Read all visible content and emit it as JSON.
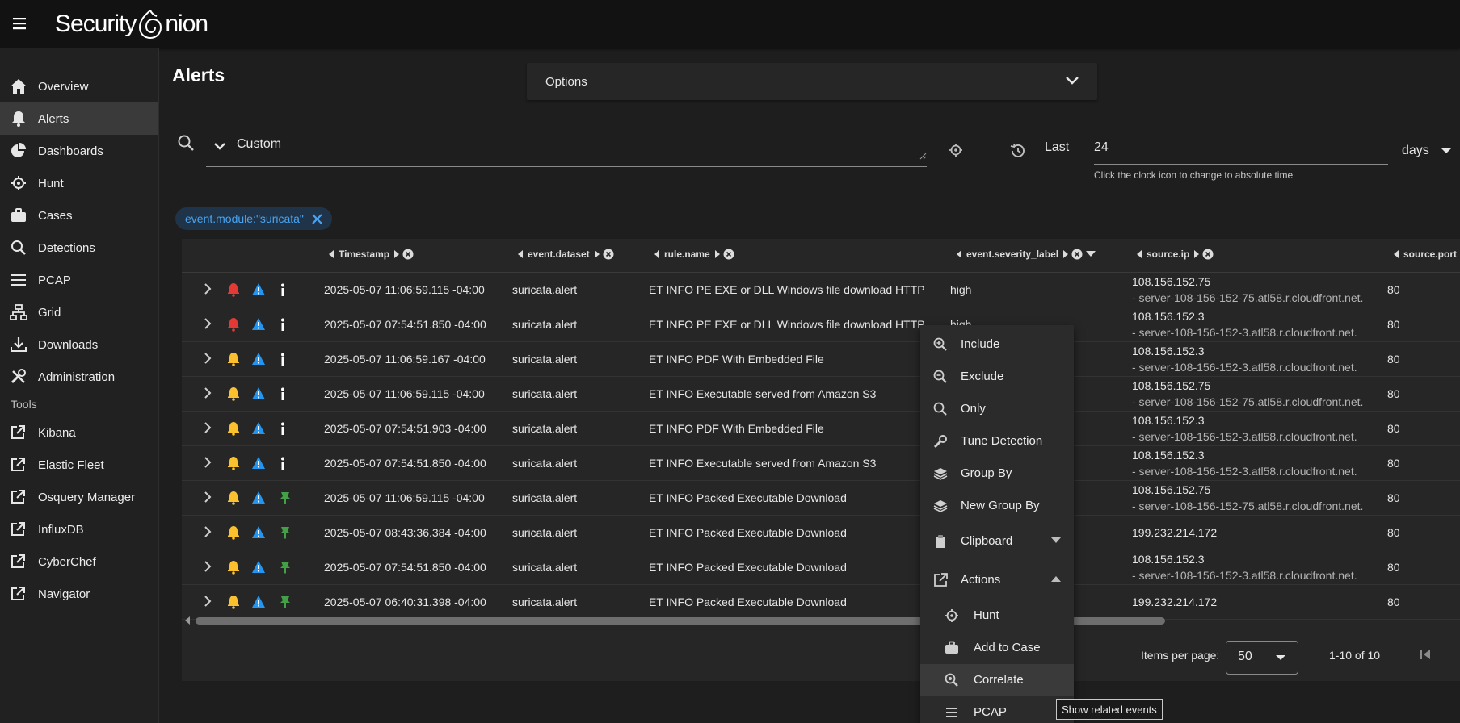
{
  "app": {
    "brand_left": "Security",
    "brand_right": "nion"
  },
  "sidebar": {
    "items": [
      {
        "label": "Overview",
        "icon": "home-icon"
      },
      {
        "label": "Alerts",
        "icon": "bell-icon"
      },
      {
        "label": "Dashboards",
        "icon": "pie-chart-icon"
      },
      {
        "label": "Hunt",
        "icon": "crosshairs-icon"
      },
      {
        "label": "Cases",
        "icon": "briefcase-icon"
      },
      {
        "label": "Detections",
        "icon": "search-icon"
      },
      {
        "label": "PCAP",
        "icon": "lines-icon"
      },
      {
        "label": "Grid",
        "icon": "network-icon"
      },
      {
        "label": "Downloads",
        "icon": "download-icon"
      },
      {
        "label": "Administration",
        "icon": "tools-icon"
      }
    ],
    "tools_title": "Tools",
    "tools": [
      {
        "label": "Kibana",
        "icon": "external-link-icon"
      },
      {
        "label": "Elastic Fleet",
        "icon": "external-link-icon"
      },
      {
        "label": "Osquery Manager",
        "icon": "external-link-icon"
      },
      {
        "label": "InfluxDB",
        "icon": "external-link-icon"
      },
      {
        "label": "CyberChef",
        "icon": "external-link-icon"
      },
      {
        "label": "Navigator",
        "icon": "external-link-icon"
      }
    ]
  },
  "main": {
    "title": "Alerts",
    "options_label": "Options",
    "query_value": "Custom",
    "last_label": "Last",
    "last_value": "24",
    "time_hint": "Click the clock icon to change to absolute time",
    "time_unit": "days",
    "filter_chip": "event.module:\"suricata\""
  },
  "table": {
    "columns": [
      "Timestamp",
      "event.dataset",
      "rule.name",
      "event.severity_label",
      "source.ip",
      "source.port"
    ],
    "rows": [
      {
        "ts": "2025-05-07 11:06:59.115 -04:00",
        "dataset": "suricata.alert",
        "rule": "ET INFO PE EXE or DLL Windows file download HTTP",
        "severity": "high",
        "ip": "108.156.152.75",
        "host": "- server-108-156-152-75.atl58.r.cloudfront.net.",
        "port": "80",
        "bell": "#e53935",
        "third": "info"
      },
      {
        "ts": "2025-05-07 07:54:51.850 -04:00",
        "dataset": "suricata.alert",
        "rule": "ET INFO PE EXE or DLL Windows file download HTTP",
        "severity": "high",
        "ip": "108.156.152.3",
        "host": "- server-108-156-152-3.atl58.r.cloudfront.net.",
        "port": "80",
        "bell": "#e53935",
        "third": "info"
      },
      {
        "ts": "2025-05-07 11:06:59.167 -04:00",
        "dataset": "suricata.alert",
        "rule": "ET INFO PDF With Embedded File",
        "severity": "",
        "ip": "108.156.152.3",
        "host": "- server-108-156-152-3.atl58.r.cloudfront.net.",
        "port": "80",
        "bell": "#fbc02d",
        "third": "info"
      },
      {
        "ts": "2025-05-07 11:06:59.115 -04:00",
        "dataset": "suricata.alert",
        "rule": "ET INFO Executable served from Amazon S3",
        "severity": "",
        "ip": "108.156.152.75",
        "host": "- server-108-156-152-75.atl58.r.cloudfront.net.",
        "port": "80",
        "bell": "#fbc02d",
        "third": "info"
      },
      {
        "ts": "2025-05-07 07:54:51.903 -04:00",
        "dataset": "suricata.alert",
        "rule": "ET INFO PDF With Embedded File",
        "severity": "",
        "ip": "108.156.152.3",
        "host": "- server-108-156-152-3.atl58.r.cloudfront.net.",
        "port": "80",
        "bell": "#fbc02d",
        "third": "info"
      },
      {
        "ts": "2025-05-07 07:54:51.850 -04:00",
        "dataset": "suricata.alert",
        "rule": "ET INFO Executable served from Amazon S3",
        "severity": "",
        "ip": "108.156.152.3",
        "host": "- server-108-156-152-3.atl58.r.cloudfront.net.",
        "port": "80",
        "bell": "#fbc02d",
        "third": "info"
      },
      {
        "ts": "2025-05-07 11:06:59.115 -04:00",
        "dataset": "suricata.alert",
        "rule": "ET INFO Packed Executable Download",
        "severity": "",
        "ip": "108.156.152.75",
        "host": "- server-108-156-152-75.atl58.r.cloudfront.net.",
        "port": "80",
        "bell": "#fbc02d",
        "third": "pin"
      },
      {
        "ts": "2025-05-07 08:43:36.384 -04:00",
        "dataset": "suricata.alert",
        "rule": "ET INFO Packed Executable Download",
        "severity": "",
        "ip": "199.232.214.172",
        "host": "",
        "port": "80",
        "bell": "#fbc02d",
        "third": "pin"
      },
      {
        "ts": "2025-05-07 07:54:51.850 -04:00",
        "dataset": "suricata.alert",
        "rule": "ET INFO Packed Executable Download",
        "severity": "",
        "ip": "108.156.152.3",
        "host": "- server-108-156-152-3.atl58.r.cloudfront.net.",
        "port": "80",
        "bell": "#fbc02d",
        "third": "pin"
      },
      {
        "ts": "2025-05-07 06:40:31.398 -04:00",
        "dataset": "suricata.alert",
        "rule": "ET INFO Packed Executable Download",
        "severity": "",
        "ip": "199.232.214.172",
        "host": "",
        "port": "80",
        "bell": "#fbc02d",
        "third": "pin"
      }
    ],
    "items_per_page_label": "Items per page:",
    "items_per_page": "50",
    "range": "1-10 of 10"
  },
  "context_menu": {
    "items": [
      {
        "label": "Include",
        "icon": "zoom-in-icon"
      },
      {
        "label": "Exclude",
        "icon": "zoom-out-icon"
      },
      {
        "label": "Only",
        "icon": "magnify-icon"
      },
      {
        "label": "Tune Detection",
        "icon": "wrench-icon"
      },
      {
        "label": "Group By",
        "icon": "layers-icon"
      },
      {
        "label": "New Group By",
        "icon": "layers-icon"
      },
      {
        "label": "Clipboard",
        "icon": "clipboard-icon"
      },
      {
        "label": "Actions",
        "icon": "external-link-icon"
      },
      {
        "label": "Hunt",
        "icon": "crosshairs-icon"
      },
      {
        "label": "Add to Case",
        "icon": "briefcase-icon"
      },
      {
        "label": "Correlate",
        "icon": "zoom-search-icon"
      },
      {
        "label": "PCAP",
        "icon": "lines-icon"
      }
    ],
    "tooltip": "Show related events"
  },
  "colors": {
    "accent": "#4aa3f0",
    "bell_red": "#e53935",
    "bell_yellow": "#fbc02d",
    "pin_green": "#43a047",
    "warn_blue": "#2196f3"
  }
}
